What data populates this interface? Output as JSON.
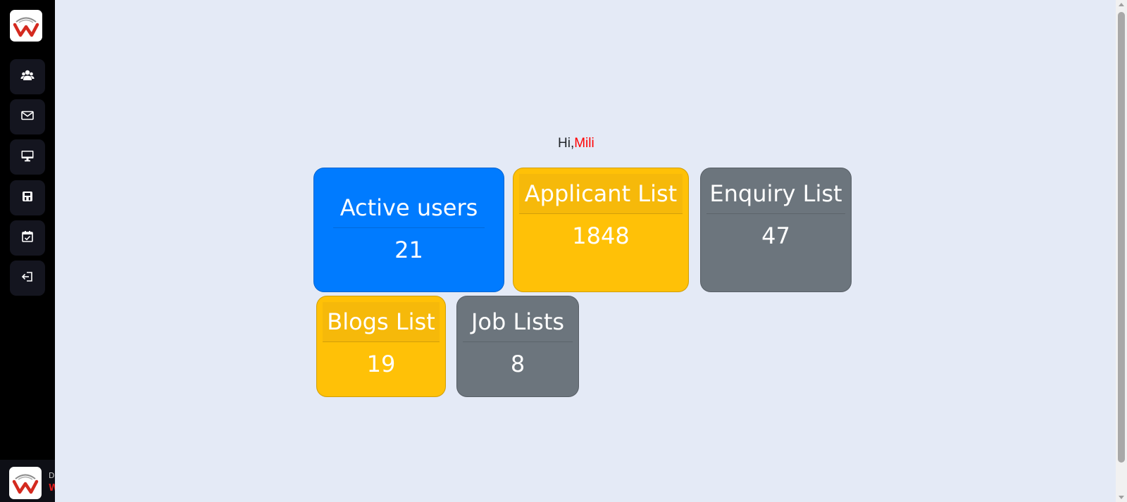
{
  "greeting": {
    "prefix": "Hi,",
    "name": "Mili"
  },
  "sidebar": {
    "logo_icon": "brand-logo-icon",
    "items": [
      {
        "icon": "users-icon"
      },
      {
        "icon": "envelope-icon"
      },
      {
        "icon": "desktop-icon"
      },
      {
        "icon": "save-icon"
      },
      {
        "icon": "calendar-check-icon"
      },
      {
        "icon": "sign-out-icon"
      }
    ]
  },
  "profile": {
    "name": "D",
    "role": "W"
  },
  "cards": [
    {
      "title": "Active users",
      "value": "21",
      "color": "#007bff"
    },
    {
      "title": "Applicant List",
      "value": "1848",
      "color": "#ffc107"
    },
    {
      "title": "Enquiry List",
      "value": "47",
      "color": "#6c757d"
    },
    {
      "title": "Blogs List",
      "value": "19",
      "color": "#ffc107"
    },
    {
      "title": "Job Lists",
      "value": "8",
      "color": "#6c757d"
    }
  ]
}
